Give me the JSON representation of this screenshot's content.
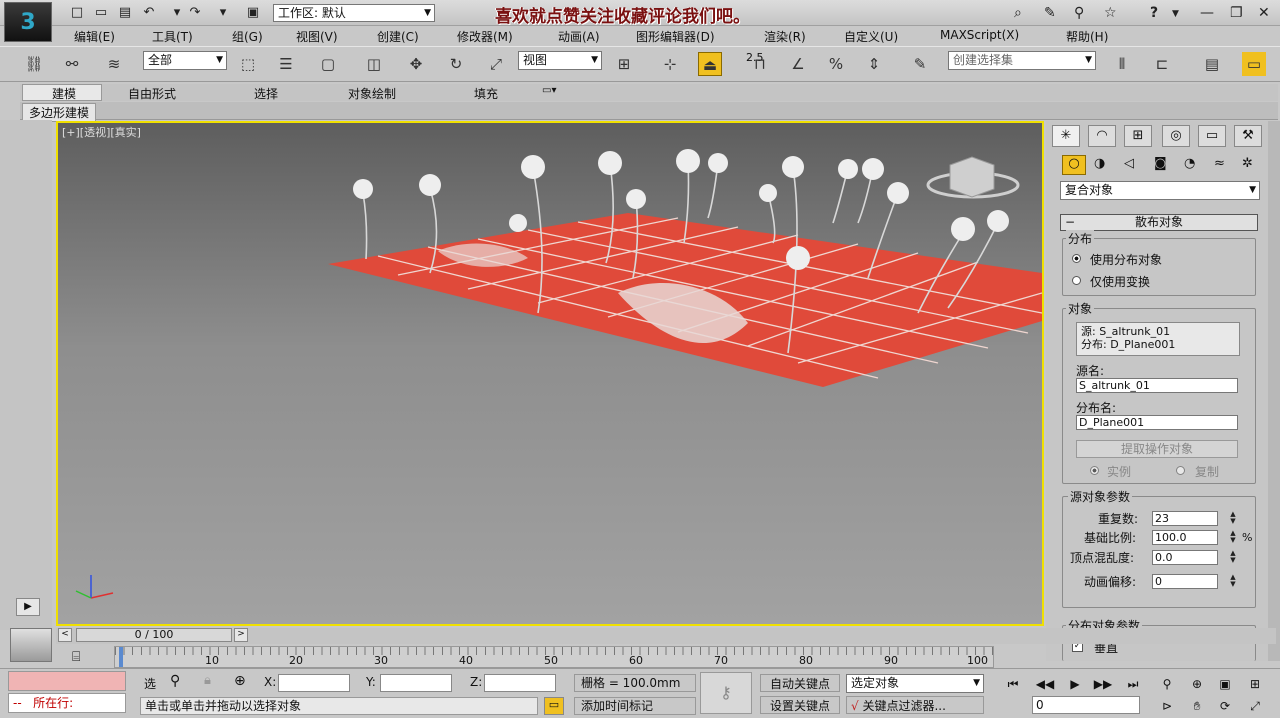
{
  "app": {
    "logo": "3",
    "workspace": "工作区: 默认",
    "banner": "喜欢就点赞关注收藏评论我们吧。",
    "help_glyph": "?"
  },
  "menus": [
    "编辑(E)",
    "工具(T)",
    "组(G)",
    "视图(V)",
    "创建(C)",
    "修改器(M)",
    "动画(A)",
    "图形编辑器(D)",
    "渲染(R)",
    "自定义(U)",
    "MAXScript(X)",
    "帮助(H)"
  ],
  "toolbar": {
    "filter": "全部",
    "refcoord": "视图",
    "snap_angle": "2.5",
    "percent": "%",
    "named_selection_placeholder": "创建选择集"
  },
  "ribbon": {
    "tabs": [
      "建模",
      "自由形式",
      "选择",
      "对象绘制",
      "填充"
    ],
    "subtitle": "多边形建模"
  },
  "viewport": {
    "label": "[+][透视][真实]"
  },
  "panel": {
    "category": "复合对象",
    "rollout_title": "散布对象",
    "distribution": {
      "title": "分布",
      "opt1": "使用分布对象",
      "opt2": "仅使用变换"
    },
    "objects": {
      "title": "对象",
      "list1": "源: S_altrunk_01",
      "list2": "分布: D_Plane001",
      "source_name_label": "源名:",
      "source_name": "S_altrunk_01",
      "dist_name_label": "分布名:",
      "dist_name": "D_Plane001",
      "extract_btn": "提取操作对象",
      "instance": "实例",
      "copy": "复制"
    },
    "source_params": {
      "title": "源对象参数",
      "dup_label": "重复数:",
      "dup": "23",
      "scale_label": "基础比例:",
      "scale": "100.0",
      "scale_unit": "%",
      "vchaos_label": "顶点混乱度:",
      "vchaos": "0.0",
      "anim_label": "动画偏移:",
      "anim": "0"
    },
    "dist_params": {
      "title": "分布对象参数",
      "perp": "垂直"
    }
  },
  "timeline": {
    "frame": "0 / 100",
    "ticks": [
      "0",
      "10",
      "20",
      "30",
      "40",
      "50",
      "60",
      "70",
      "80",
      "90",
      "100"
    ]
  },
  "status": {
    "sel_label": "选",
    "x_label": "X:",
    "y_label": "Y:",
    "z_label": "Z:",
    "grid": "栅格 = 100.0mm",
    "add_time_tag": "添加时间标记",
    "auto_key": "自动关键点",
    "set_key": "设置关键点",
    "sel_object": "选定对象",
    "key_filters": "关键点过滤器...",
    "frame_field": "0",
    "prompt": "单击或单击并拖动以选择对象",
    "row_label": "所在行:",
    "row_dash": "--"
  },
  "colors": {
    "plane": "#e04a3a",
    "viewport_border": "#f0e000",
    "banner": "#7a1010"
  }
}
